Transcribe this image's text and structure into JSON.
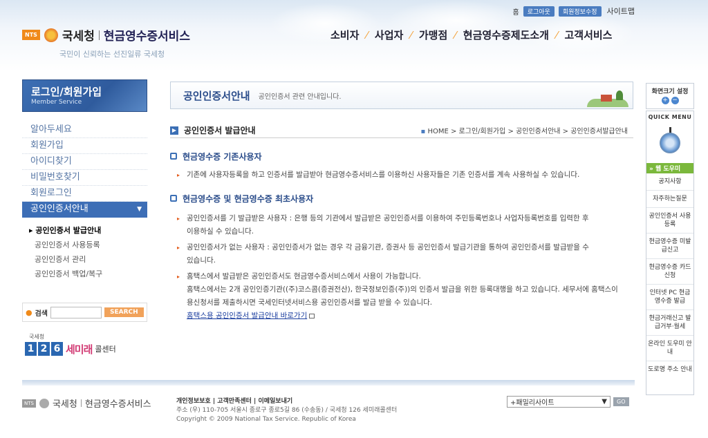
{
  "header": {
    "top_links": {
      "home": "홈",
      "login": "로그아웃",
      "member_info": "회원정보수정",
      "sitemap": "사이트맵"
    },
    "logo": {
      "nts": "NTS",
      "agency": "국세청",
      "service": "현금영수증서비스"
    },
    "slogan": "국민이 신뢰하는 선진일류 국세청",
    "gnb": [
      "소비자",
      "사업자",
      "가맹점",
      "현금영수증제도소개",
      "고객서비스"
    ]
  },
  "sidebar": {
    "login_title": "로그인/회원가입",
    "login_subtitle": "Member Service",
    "items": [
      {
        "label": "알아두세요"
      },
      {
        "label": "회원가입"
      },
      {
        "label": "아이디찾기"
      },
      {
        "label": "비밀번호찾기"
      },
      {
        "label": "회원로그인"
      },
      {
        "label": "공인인증서안내"
      }
    ],
    "subitems": [
      {
        "label": "공인인증서 발급안내"
      },
      {
        "label": "공인인증서 사용등록"
      },
      {
        "label": "공인인증서 관리"
      },
      {
        "label": "공인인증서 백업/복구"
      }
    ],
    "search": {
      "label": "검색",
      "button": "SEARCH",
      "value": ""
    },
    "callcenter": {
      "small": "국세청",
      "digits": [
        "1",
        "2",
        "6"
      ],
      "name": "세미래",
      "suffix": "콜센터"
    }
  },
  "main": {
    "banner_title": "공인인증서안내",
    "banner_subtitle": "공인인증서 관련 안내입니다.",
    "section_title": "공인인증서 발급안내",
    "breadcrumb": "HOME > 로그인/회원가입 > 공인인증서안내 > 공인인증서발급안내",
    "blocks": [
      {
        "heading": "현금영수증 기존사용자",
        "paras": [
          "기존에 사용자등록을 하고 인증서를 발급받아 현금영수증서비스를 이용하신 사용자들은 기존 인증서를 계속 사용하실 수 있습니다."
        ]
      },
      {
        "heading": "현금영수증 및 현금영수증 최초사용자",
        "paras": [
          "공인인증서를 기 발급받은 사용자 : 은행 등의 기관에서 발급받은 공인인증서를 이용하여 주민등록번호나 사업자등록번호를 입력한 후 이용하실 수 있습니다.",
          "공인인증서가 없는 사용자 : 공인인증서가 없는 경우 각 금융기관, 증권사 등 공인인증서 발급기관을 통하여 공인인증서를 발급받을 수 있습니다.",
          "홈택스에서 발급받은 공인인증서도 현금영수증서비스에서 사용이 가능합니다.",
          "홈택스에서는 2개 공인인증기관((주)코스콤(증권전산), 한국정보인증(주))의 인증서 발급을 위한 등록대행을 하고 있습니다. 세무서에 홈택스이용신청서를 제출하시면 국세인터넷서비스용 공인인증서를 발급 받을 수 있습니다."
        ],
        "link": "홈택스용 공인인증서 발급안내 바로가기"
      }
    ]
  },
  "quick": {
    "font_title": "화면크기 설정",
    "font_plus": "+",
    "font_minus": "−",
    "menu_title": "QUICK MENU",
    "help": "» 웹 도우미",
    "items": [
      "공지사항",
      "자주하는질문",
      "공인인증서 사용등록",
      "현금영수증 미발급신고",
      "현금영수증 카드신청",
      "인터넷 PC 현금영수증 발급",
      "현금거래신고 발급거부·월세",
      "온라인 도우미 안내",
      "도로명 주소 안내"
    ]
  },
  "footer": {
    "links": "개인정보보호 | 고객만족센터 | 이메일보내기",
    "address": "주소 (우) 110-705 서울시 종로구 종로5길 86 (수송동) / 국세청 126 세미래콜센터",
    "copyright": "Copyright © 2009 National Tax Service. Republic of Korea",
    "family_site": "+패밀리사이트",
    "go": "GO"
  }
}
